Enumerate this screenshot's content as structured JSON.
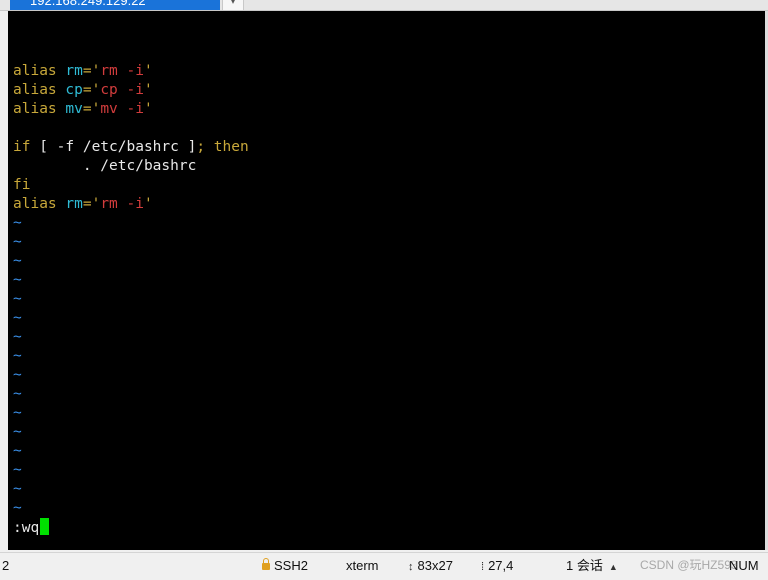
{
  "tab": {
    "title": "192.168.249.129:22",
    "dropdown_icon": "chevron-down-icon"
  },
  "terminal": {
    "lines": [
      {
        "parts": []
      },
      {
        "parts": []
      },
      {
        "parts": [
          {
            "t": "alias ",
            "c": "y"
          },
          {
            "t": "rm",
            "c": "c"
          },
          {
            "t": "='",
            "c": "y"
          },
          {
            "t": "rm -i",
            "c": "r"
          },
          {
            "t": "'",
            "c": "y"
          }
        ]
      },
      {
        "parts": [
          {
            "t": "alias ",
            "c": "y"
          },
          {
            "t": "cp",
            "c": "c"
          },
          {
            "t": "='",
            "c": "y"
          },
          {
            "t": "cp -i",
            "c": "r"
          },
          {
            "t": "'",
            "c": "y"
          }
        ]
      },
      {
        "parts": [
          {
            "t": "alias ",
            "c": "y"
          },
          {
            "t": "mv",
            "c": "c"
          },
          {
            "t": "='",
            "c": "y"
          },
          {
            "t": "mv -i",
            "c": "r"
          },
          {
            "t": "'",
            "c": "y"
          }
        ]
      },
      {
        "parts": []
      },
      {
        "parts": [
          {
            "t": "if",
            "c": "y"
          },
          {
            "t": " [ -f /etc/bashrc ]",
            "c": "w"
          },
          {
            "t": "; then",
            "c": "y"
          }
        ]
      },
      {
        "parts": [
          {
            "t": "        . /etc/bashrc",
            "c": "w"
          }
        ]
      },
      {
        "parts": [
          {
            "t": "fi",
            "c": "y"
          }
        ]
      },
      {
        "parts": [
          {
            "t": "alias ",
            "c": "y"
          },
          {
            "t": "rm",
            "c": "c"
          },
          {
            "t": "='",
            "c": "y"
          },
          {
            "t": "rm -i",
            "c": "r"
          },
          {
            "t": "'",
            "c": "y"
          }
        ]
      },
      {
        "parts": [
          {
            "t": "~",
            "c": "tilde"
          }
        ]
      },
      {
        "parts": [
          {
            "t": "~",
            "c": "tilde"
          }
        ]
      },
      {
        "parts": [
          {
            "t": "~",
            "c": "tilde"
          }
        ]
      },
      {
        "parts": [
          {
            "t": "~",
            "c": "tilde"
          }
        ]
      },
      {
        "parts": [
          {
            "t": "~",
            "c": "tilde"
          }
        ]
      },
      {
        "parts": [
          {
            "t": "~",
            "c": "tilde"
          }
        ]
      },
      {
        "parts": [
          {
            "t": "~",
            "c": "tilde"
          }
        ]
      },
      {
        "parts": [
          {
            "t": "~",
            "c": "tilde"
          }
        ]
      },
      {
        "parts": [
          {
            "t": "~",
            "c": "tilde"
          }
        ]
      },
      {
        "parts": [
          {
            "t": "~",
            "c": "tilde"
          }
        ]
      },
      {
        "parts": [
          {
            "t": "~",
            "c": "tilde"
          }
        ]
      },
      {
        "parts": [
          {
            "t": "~",
            "c": "tilde"
          }
        ]
      },
      {
        "parts": [
          {
            "t": "~",
            "c": "tilde"
          }
        ]
      },
      {
        "parts": [
          {
            "t": "~",
            "c": "tilde"
          }
        ]
      },
      {
        "parts": [
          {
            "t": "~",
            "c": "tilde"
          }
        ]
      },
      {
        "parts": [
          {
            "t": "~",
            "c": "tilde"
          }
        ]
      }
    ],
    "command_line": ":wq"
  },
  "statusbar": {
    "left_number": "2",
    "protocol": "SSH2",
    "terminal_type": "xterm",
    "size": "83x27",
    "cursor_position": "27,4",
    "sessions": "1 会话",
    "num_lock": "NUM",
    "watermark": "CSDN @玩HZ593"
  },
  "colors": {
    "keyword_yellow": "#c8a83a",
    "identifier_cyan": "#2fbcd6",
    "string_red": "#d23c3c",
    "tilde_blue": "#3a8fe8",
    "cursor_green": "#00e000",
    "tab_blue": "#1a73d9"
  }
}
